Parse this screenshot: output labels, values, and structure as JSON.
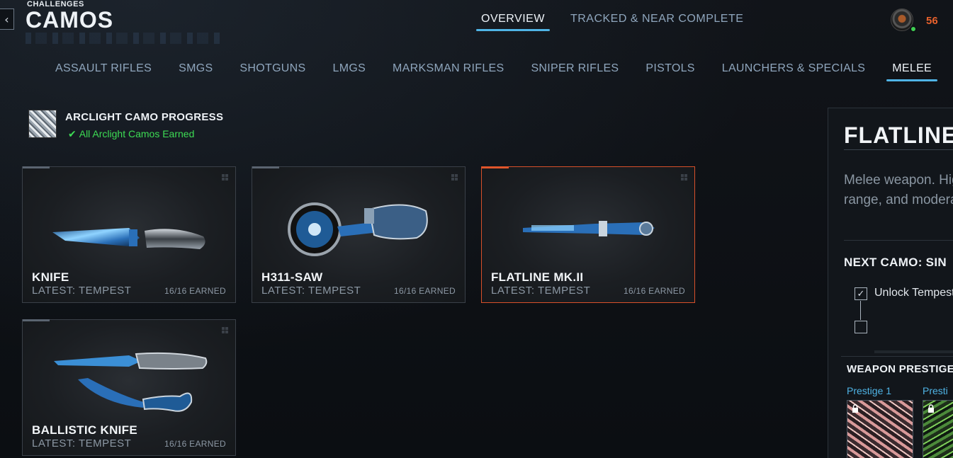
{
  "header": {
    "supertitle": "CHALLENGES",
    "title": "CAMOS",
    "back_glyph": "‹"
  },
  "top_tabs": [
    {
      "label": "OVERVIEW",
      "active": true
    },
    {
      "label": "TRACKED & NEAR COMPLETE",
      "active": false
    }
  ],
  "player": {
    "level": "56",
    "online_color": "#3fce52"
  },
  "category_tabs": [
    {
      "label": "ASSAULT RIFLES",
      "active": false
    },
    {
      "label": "SMGS",
      "active": false
    },
    {
      "label": "SHOTGUNS",
      "active": false
    },
    {
      "label": "LMGS",
      "active": false
    },
    {
      "label": "MARKSMAN RIFLES",
      "active": false
    },
    {
      "label": "SNIPER RIFLES",
      "active": false
    },
    {
      "label": "PISTOLS",
      "active": false
    },
    {
      "label": "LAUNCHERS & SPECIALS",
      "active": false
    },
    {
      "label": "MELEE",
      "active": true
    }
  ],
  "arclight": {
    "title": "ARCLIGHT CAMO PROGRESS",
    "check_glyph": "✔",
    "status": "All Arclight Camos Earned"
  },
  "weapons": [
    {
      "name": "KNIFE",
      "latest": "LATEST: TEMPEST",
      "earned": "16/16 EARNED",
      "selected": false
    },
    {
      "name": "H311-SAW",
      "latest": "LATEST: TEMPEST",
      "earned": "16/16 EARNED",
      "selected": false
    },
    {
      "name": "FLATLINE MK.II",
      "latest": "LATEST: TEMPEST",
      "earned": "16/16 EARNED",
      "selected": true
    },
    {
      "name": "BALLISTIC KNIFE",
      "latest": "LATEST: TEMPEST",
      "earned": "16/16 EARNED",
      "selected": false
    }
  ],
  "detail": {
    "title": "FLATLINE",
    "description_line1": "Melee weapon. Hig",
    "description_line2": "range, and modera",
    "next_camo": "NEXT CAMO: SIN",
    "check_glyph": "✓",
    "challenge_label": "Unlock Tempest C",
    "prestige_title": "WEAPON PRESTIGE",
    "prestige": [
      {
        "label": "Prestige 1"
      },
      {
        "label": "Presti"
      }
    ]
  },
  "colors": {
    "accent": "#4fb4e6",
    "selected_border": "#d8502a",
    "success": "#3ddc54",
    "level": "#e8612c"
  }
}
